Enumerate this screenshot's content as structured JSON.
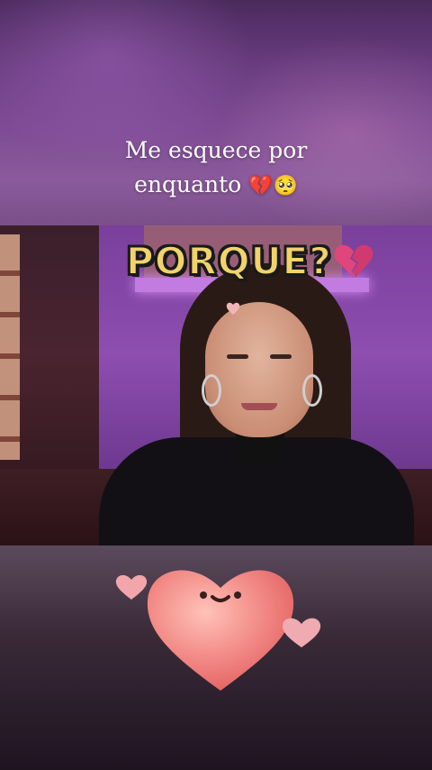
{
  "caption": {
    "line1": "Me esquece por",
    "line2": "enquanto",
    "emojis": "💔🥺"
  },
  "video": {
    "overlay_text": "PORQUE?",
    "overlay_color": "#f2d36b"
  },
  "icons": {
    "broken_heart": "broken-heart-icon",
    "small_heart": "small-heart-icon",
    "big_heart": "smiling-heart-icon",
    "mini_hearts": "pink-heart-icon"
  },
  "colors": {
    "heart_pink": "#f28a86",
    "broken_heart": "#e0457b"
  }
}
